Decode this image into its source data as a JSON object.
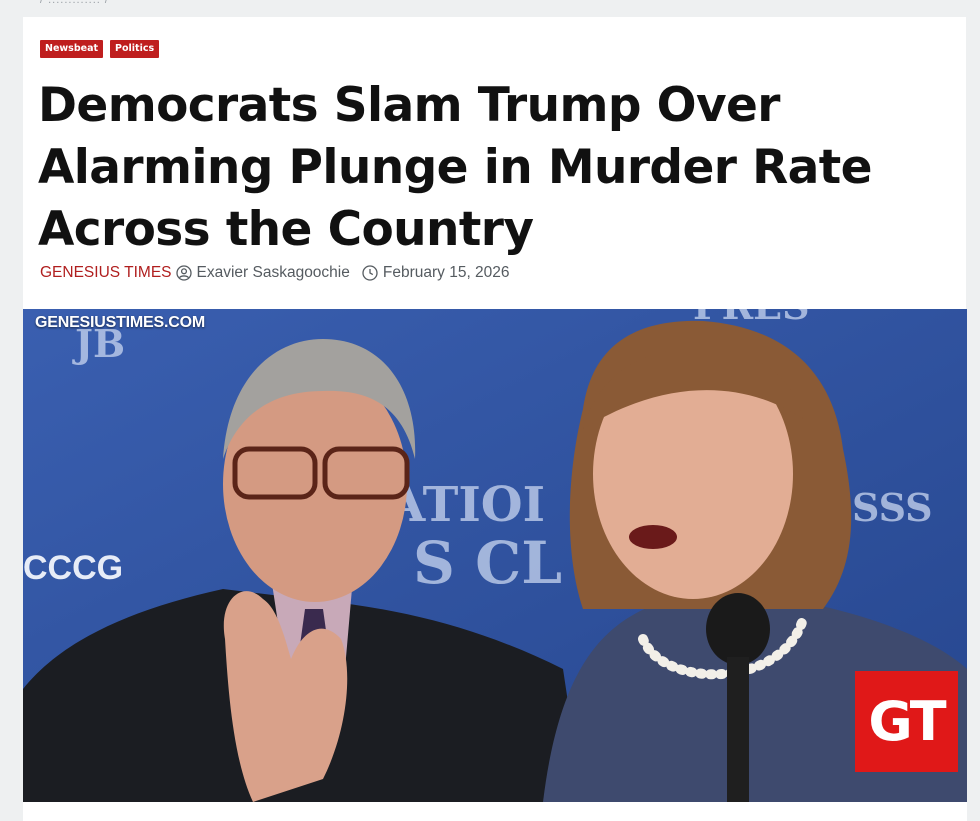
{
  "breadcrumb": "/ ............. /",
  "categories": [
    {
      "label": "Newsbeat"
    },
    {
      "label": "Politics"
    }
  ],
  "article": {
    "title_lines": [
      "Democrats Slam Trump Over",
      "Alarming Plunge in Murder Rate",
      "Across the Country"
    ],
    "site": "GENESIUS TIMES",
    "author": "Exavier Saskagoochie",
    "date": "February 15, 2026"
  },
  "image": {
    "watermark": "GENESIUSTIMES.COM",
    "logo": "GT",
    "backdrop_text": [
      "JB",
      "ATIOI",
      "S CL",
      "ESSS",
      "CCCG",
      "PRES"
    ],
    "description_icon": "press-conference-photo"
  },
  "icons": {
    "author": "user-circle-icon",
    "date": "clock-icon"
  },
  "colors": {
    "badge": "#bf1e1e",
    "brand": "#b01e1e",
    "logo": "#e01818",
    "backdrop": "#2d4f9c"
  }
}
